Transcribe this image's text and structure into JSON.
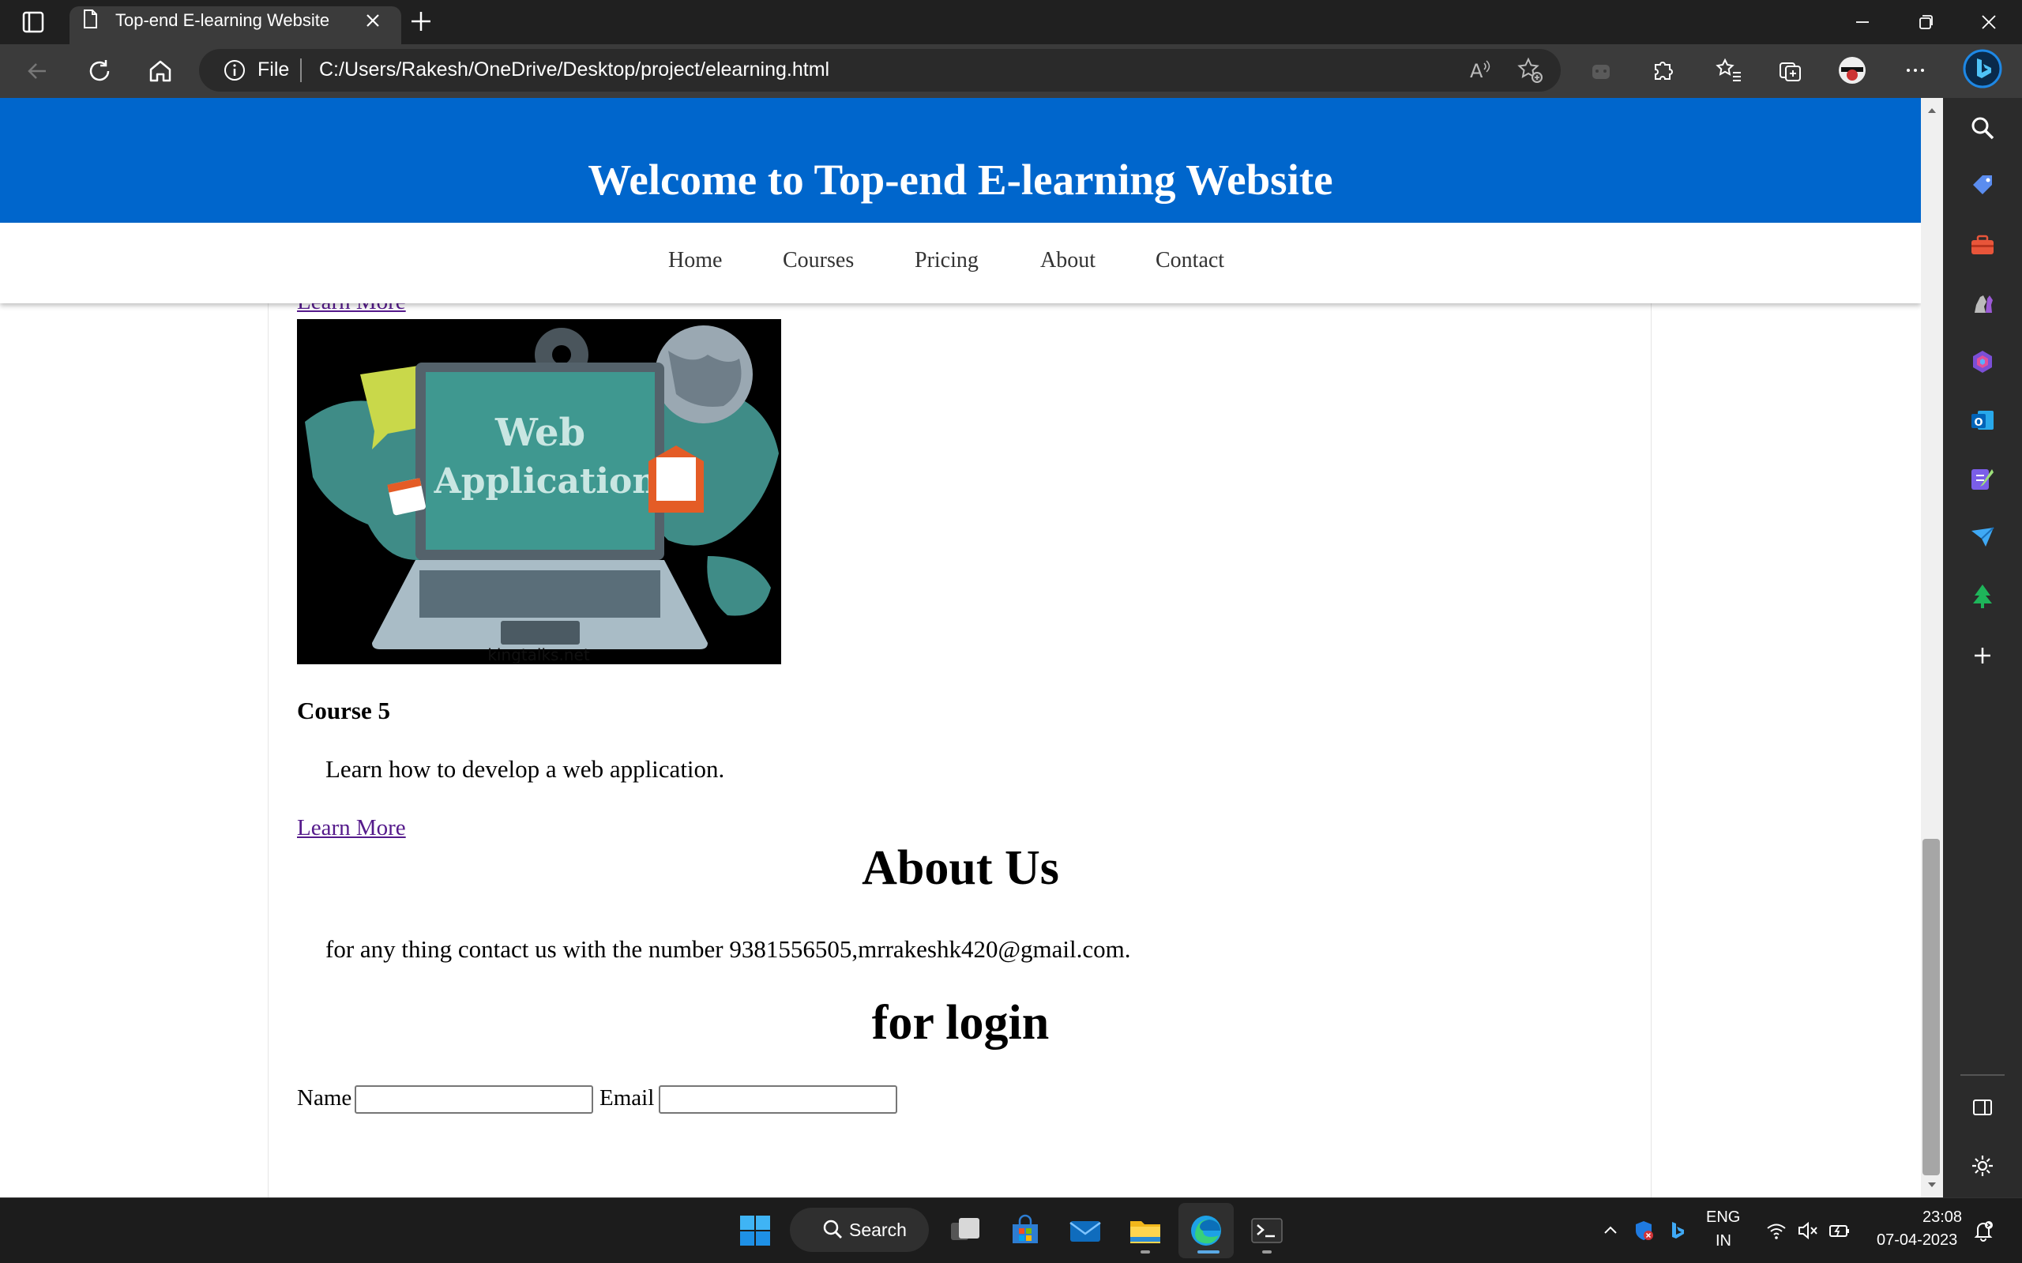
{
  "browser": {
    "tab_title": "Top-end E-learning Website",
    "url_scheme": "File",
    "url": "C:/Users/Rakesh/OneDrive/Desktop/project/elearning.html"
  },
  "page": {
    "header_title": "Welcome to Top-end E-learning Website",
    "nav": [
      "Home",
      "Courses",
      "Pricing",
      "About",
      "Contact"
    ],
    "learn_more_top": "Learn More",
    "course": {
      "image_text_line1": "Web",
      "image_text_line2": "Application",
      "image_watermark": "kingtalks.net",
      "title": "Course 5",
      "description": "Learn how to develop a web application.",
      "learn_more": "Learn More"
    },
    "about": {
      "heading": "About Us",
      "text": "for any thing contact us with the number 9381556505,mrrakeshk420@gmail.com."
    },
    "login": {
      "heading": "for login",
      "name_label": "Name",
      "email_label": "Email"
    }
  },
  "taskbar": {
    "search_label": "Search",
    "lang_line1": "ENG",
    "lang_line2": "IN",
    "time": "23:08",
    "date": "07-04-2023"
  },
  "colors": {
    "header_bg": "#0066cc",
    "visited_link": "#551a8b",
    "titlebar": "#202020",
    "addressbar": "#3b3b3b"
  }
}
